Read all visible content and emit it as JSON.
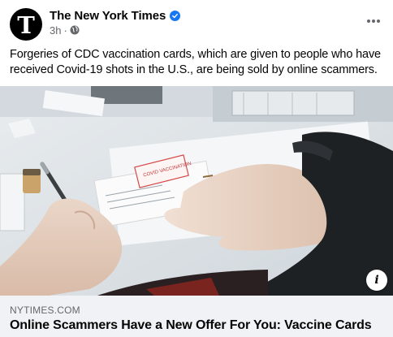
{
  "post": {
    "page_name": "The New York Times",
    "verified_icon": "verified-badge-icon",
    "timestamp": "3h",
    "separator": "·",
    "audience_icon": "globe-icon",
    "avatar_letter": "T",
    "caption": "Forgeries of CDC vaccination cards, which are given to people who have received Covid-19 shots in the U.S., are being sold by online scammers."
  },
  "photo": {
    "card_stamp_text": "COVID VACCINATION"
  },
  "link": {
    "domain": "NYTIMES.COM",
    "title": "Online Scammers Have a New Offer For You: Vaccine Cards"
  },
  "colors": {
    "brand_blue": "#1877f2",
    "secondary_text": "#65676b",
    "link_background": "#f0f2f5"
  }
}
